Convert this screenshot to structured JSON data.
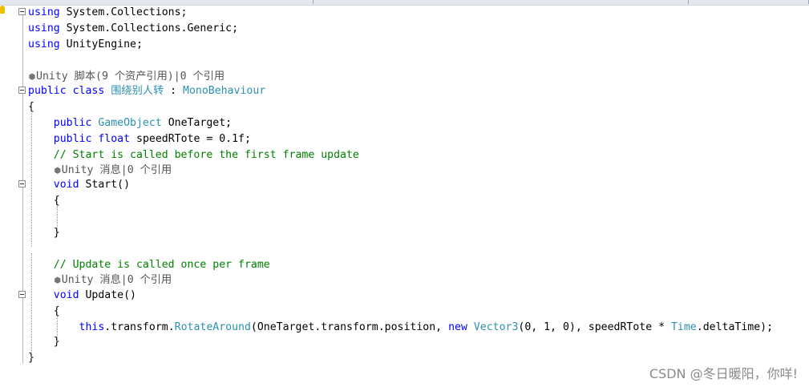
{
  "editor": {
    "lines": [
      {
        "segs": [
          {
            "c": "kw",
            "t": "using"
          },
          {
            "c": "",
            "t": " System.Collections;"
          }
        ]
      },
      {
        "segs": [
          {
            "c": "kw",
            "t": "using"
          },
          {
            "c": "",
            "t": " System.Collections.Generic;"
          }
        ]
      },
      {
        "segs": [
          {
            "c": "kw",
            "t": "using"
          },
          {
            "c": "",
            "t": " UnityEngine;"
          }
        ]
      },
      {
        "segs": []
      },
      {
        "lens": "Unity 脚本(9 个资产引用)|0 个引用"
      },
      {
        "segs": [
          {
            "c": "kw",
            "t": "public"
          },
          {
            "c": "",
            "t": " "
          },
          {
            "c": "kw",
            "t": "class"
          },
          {
            "c": "",
            "t": " "
          },
          {
            "c": "type",
            "t": "围绕别人转"
          },
          {
            "c": "",
            "t": " : "
          },
          {
            "c": "type",
            "t": "MonoBehaviour"
          }
        ]
      },
      {
        "segs": [
          {
            "c": "",
            "t": "{"
          }
        ]
      },
      {
        "segs": [
          {
            "c": "",
            "t": "    "
          },
          {
            "c": "kw",
            "t": "public"
          },
          {
            "c": "",
            "t": " "
          },
          {
            "c": "type",
            "t": "GameObject"
          },
          {
            "c": "",
            "t": " OneTarget;"
          }
        ]
      },
      {
        "segs": [
          {
            "c": "",
            "t": "    "
          },
          {
            "c": "kw",
            "t": "public"
          },
          {
            "c": "",
            "t": " "
          },
          {
            "c": "kw",
            "t": "float"
          },
          {
            "c": "",
            "t": " speedRTote = 0.1f;"
          }
        ]
      },
      {
        "segs": [
          {
            "c": "",
            "t": "    "
          },
          {
            "c": "cm",
            "t": "// Start is called before the first frame update"
          }
        ]
      },
      {
        "lens": "Unity 消息|0 个引用",
        "indent": "    "
      },
      {
        "segs": [
          {
            "c": "",
            "t": "    "
          },
          {
            "c": "kw",
            "t": "void"
          },
          {
            "c": "",
            "t": " Start()"
          }
        ]
      },
      {
        "segs": [
          {
            "c": "",
            "t": "    {"
          }
        ]
      },
      {
        "segs": []
      },
      {
        "segs": [
          {
            "c": "",
            "t": "    }"
          }
        ]
      },
      {
        "segs": []
      },
      {
        "segs": [
          {
            "c": "",
            "t": "    "
          },
          {
            "c": "cm",
            "t": "// Update is called once per frame"
          }
        ]
      },
      {
        "lens": "Unity 消息|0 个引用",
        "indent": "    "
      },
      {
        "segs": [
          {
            "c": "",
            "t": "    "
          },
          {
            "c": "kw",
            "t": "void"
          },
          {
            "c": "",
            "t": " Update()"
          }
        ]
      },
      {
        "segs": [
          {
            "c": "",
            "t": "    {"
          }
        ]
      },
      {
        "segs": [
          {
            "c": "",
            "t": "        "
          },
          {
            "c": "kw",
            "t": "this"
          },
          {
            "c": "",
            "t": ".transform."
          },
          {
            "c": "type",
            "t": "RotateAround"
          },
          {
            "c": "",
            "t": "(OneTarget.transform.position, "
          },
          {
            "c": "kw",
            "t": "new"
          },
          {
            "c": "",
            "t": " "
          },
          {
            "c": "type",
            "t": "Vector3"
          },
          {
            "c": "",
            "t": "(0, 1, 0), speedRTote * "
          },
          {
            "c": "type",
            "t": "Time"
          },
          {
            "c": "",
            "t": ".deltaTime);"
          }
        ]
      },
      {
        "segs": [
          {
            "c": "",
            "t": "    }"
          }
        ]
      },
      {
        "segs": [
          {
            "c": "",
            "t": "}"
          }
        ]
      }
    ]
  },
  "watermark": "CSDN @冬日暖阳，你咩!"
}
